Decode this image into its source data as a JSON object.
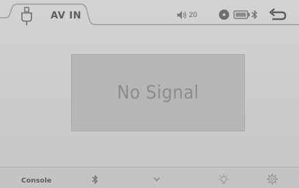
{
  "header": {
    "title": "AV IN",
    "icon": "usb-plug-icon",
    "status": {
      "volume_icon": "speaker-icon",
      "volume_level": "20",
      "disc_icon": "disc-icon",
      "battery_icon": "battery-icon",
      "bluetooth_icon": "bluetooth-icon"
    },
    "back_icon": "back-arrow-icon"
  },
  "main": {
    "message": "No Signal"
  },
  "footer": {
    "console_label": "Console",
    "items": [
      {
        "icon": "bluetooth-icon"
      },
      {
        "icon": "chevron-down-icon"
      },
      {
        "icon": "light-bulb-icon"
      },
      {
        "icon": "gear-icon"
      }
    ]
  },
  "colors": {
    "background": "#cbcbc9",
    "signal_box": "#b6b6b4",
    "text": "#5e5e5c",
    "signal_text": "#8c8c8a"
  }
}
